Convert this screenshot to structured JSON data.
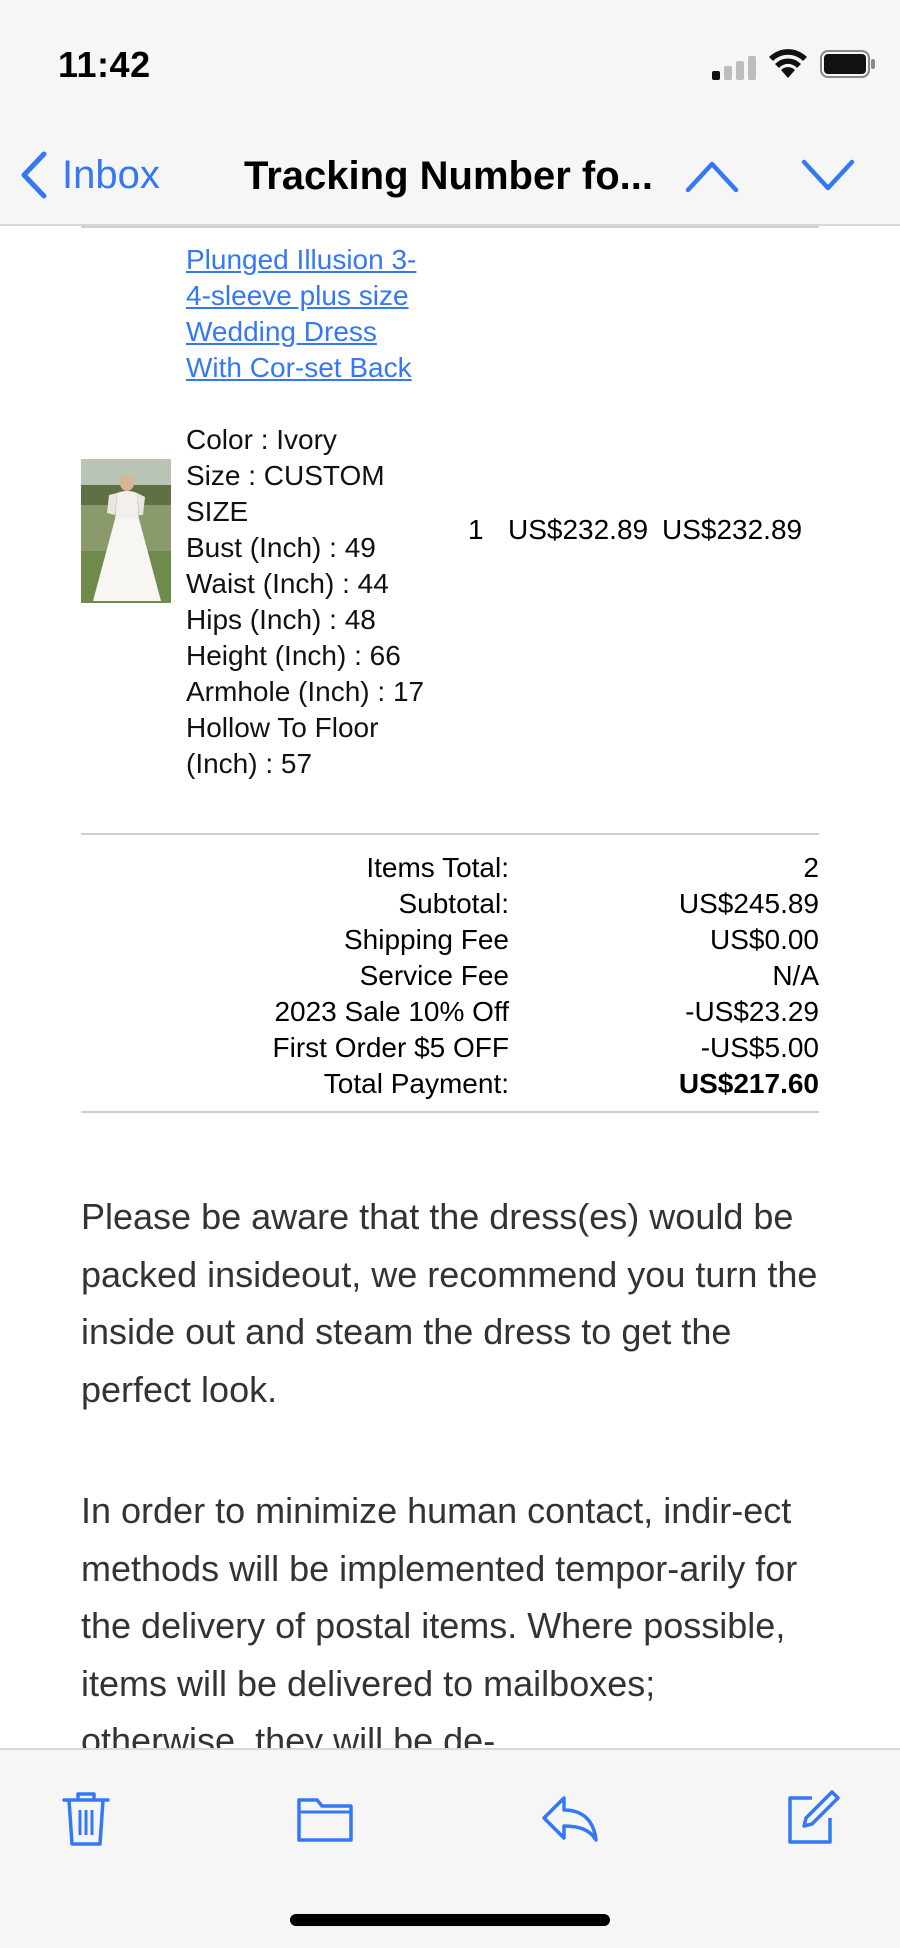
{
  "status_bar": {
    "time": "11:42"
  },
  "nav": {
    "back_label": "Inbox",
    "title": "Tracking Number fo..."
  },
  "order_item": {
    "link_text": "Plunged Illusion 3-4-sleeve plus size Wedding Dress With Cor-set Back",
    "attributes": [
      "Color : Ivory",
      "Size : CUSTOM SIZE",
      "Bust (Inch) : 49",
      "Waist (Inch) : 44",
      "Hips (Inch) : 48",
      "Height (Inch) : 66",
      "Armhole (Inch) : 17",
      "Hollow To Floor (Inch) : 57"
    ],
    "quantity": "1",
    "unit_price": "US$232.89",
    "line_total": "US$232.89"
  },
  "totals": [
    {
      "label": "Items Total:",
      "value": "2"
    },
    {
      "label": "Subtotal:",
      "value": "US$245.89"
    },
    {
      "label": "Shipping Fee",
      "value": "US$0.00"
    },
    {
      "label": "Service Fee",
      "value": "N/A"
    },
    {
      "label": "2023 Sale 10% Off",
      "value": "-US$23.29"
    },
    {
      "label": "First Order $5 OFF",
      "value": "-US$5.00"
    },
    {
      "label": "Total Payment:",
      "value": "US$217.60"
    }
  ],
  "paragraphs": {
    "p1": "Please be aware that the dress(es) would be packed insideout, we recommend you turn the inside out and steam the dress to get the perfect look.",
    "p2": "In order to minimize human contact, indir-ect methods will be implemented tempor-arily for the delivery of postal items. Where possible, items will be delivered to mailboxes; otherwise, they will be de-"
  },
  "toolbar": {
    "icons": [
      "trash-icon",
      "folder-icon",
      "reply-icon",
      "compose-icon"
    ]
  },
  "colors": {
    "accent": "#3478f6",
    "bar_bg": "#f6f6f6"
  }
}
